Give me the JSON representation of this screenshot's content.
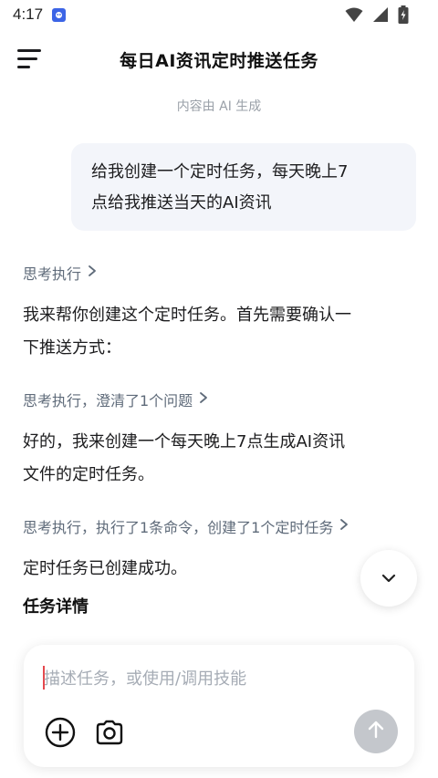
{
  "status_bar": {
    "time": "4:17",
    "icons": [
      "app-notification-icon",
      "wifi-icon",
      "signal-icon",
      "battery-charging-icon"
    ]
  },
  "header": {
    "menu_icon": "hamburger-menu-icon",
    "title": "每日AI资讯定时推送任务"
  },
  "ai_note": "内容由 AI 生成",
  "conversation": {
    "user_message": {
      "line1": "给我创建一个定时任务，每天晚上7",
      "line2": "点给我推送当天的AI资讯"
    },
    "think_1": "思考执行",
    "reply_1": {
      "line1": "我来帮你创建这个定时任务。首先需要确认一",
      "line2": "下推送方式："
    },
    "think_2": "思考执行，澄清了1个问题",
    "reply_2": {
      "line1": "好的，我来创建一个每天晚上7点生成AI资讯",
      "line2": "文件的定时任务。"
    },
    "think_3": "思考执行，执行了1条命令，创建了1个定时任务",
    "reply_3": "定时任务已创建成功。",
    "section_title": "任务详情"
  },
  "composer": {
    "placeholder": "描述任务，或使用/调用技能",
    "value": "",
    "add_icon": "add-circle-icon",
    "camera_icon": "camera-icon",
    "send_icon": "send-arrow-up-icon"
  },
  "colors": {
    "accent_muted": "#5f6b7a",
    "bubble_bg": "#f3f5fa",
    "send_disabled": "#c4c7cc",
    "caret": "#e5484d"
  }
}
